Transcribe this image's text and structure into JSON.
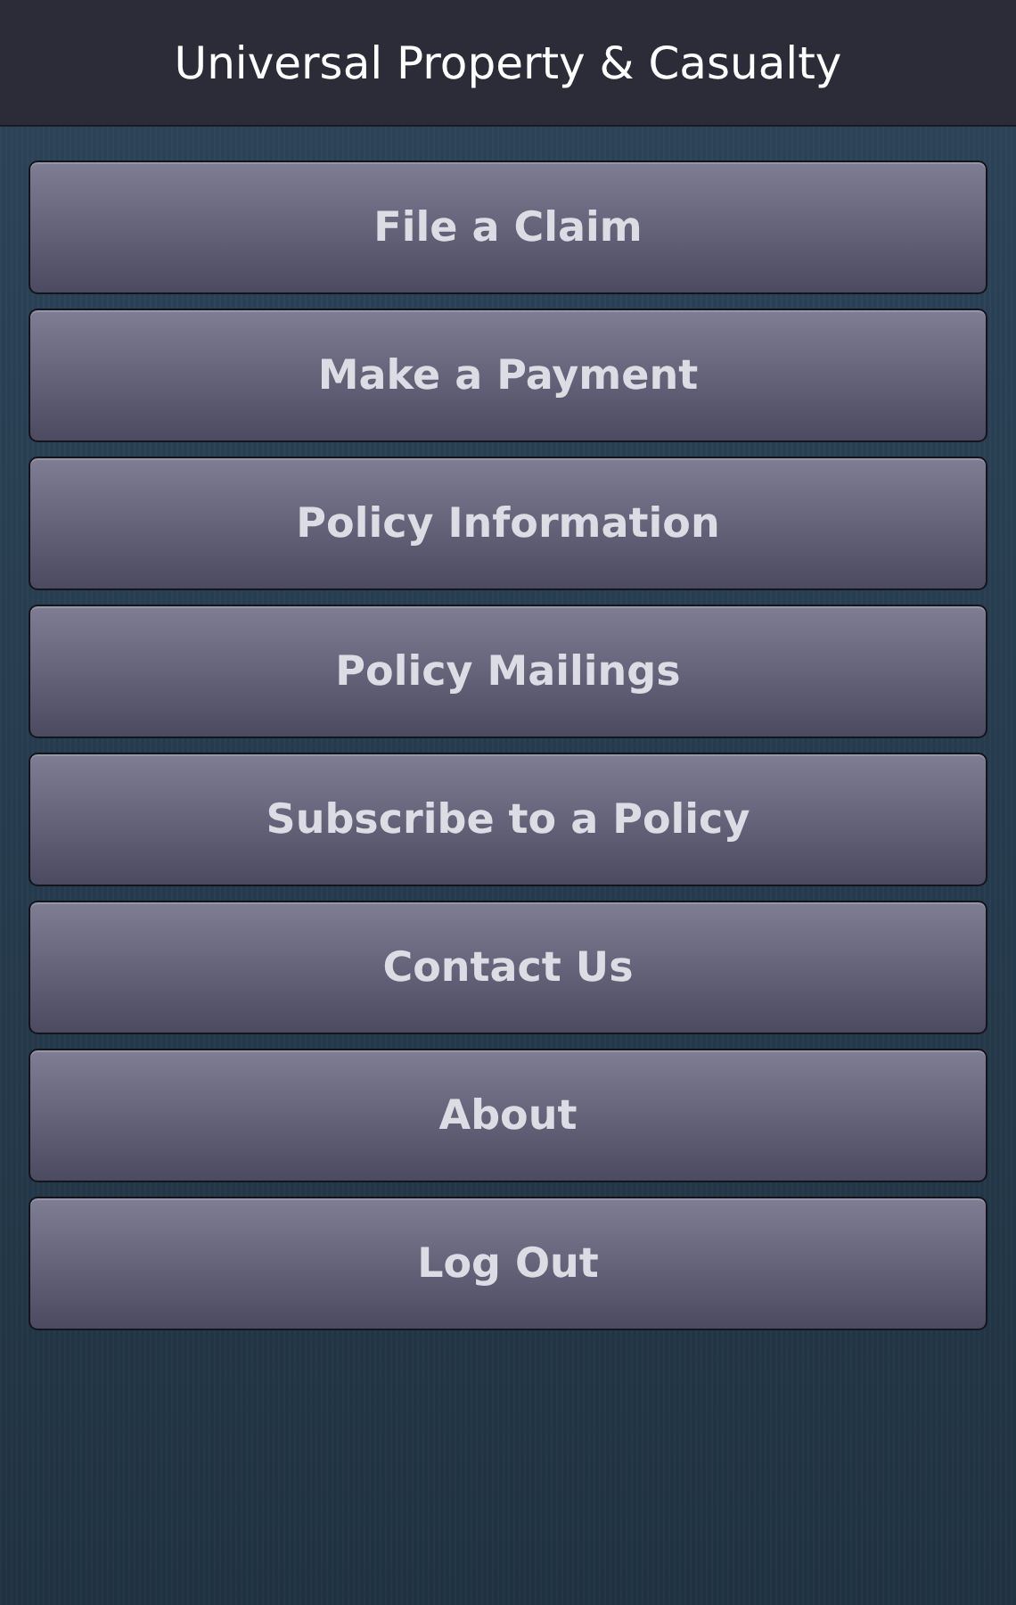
{
  "header": {
    "title": "Universal Property & Casualty"
  },
  "menu": [
    {
      "label": "File a Claim"
    },
    {
      "label": "Make a Payment"
    },
    {
      "label": "Policy Information"
    },
    {
      "label": "Policy Mailings"
    },
    {
      "label": "Subscribe to a Policy"
    },
    {
      "label": "Contact Us"
    },
    {
      "label": "About"
    },
    {
      "label": "Log Out"
    }
  ]
}
